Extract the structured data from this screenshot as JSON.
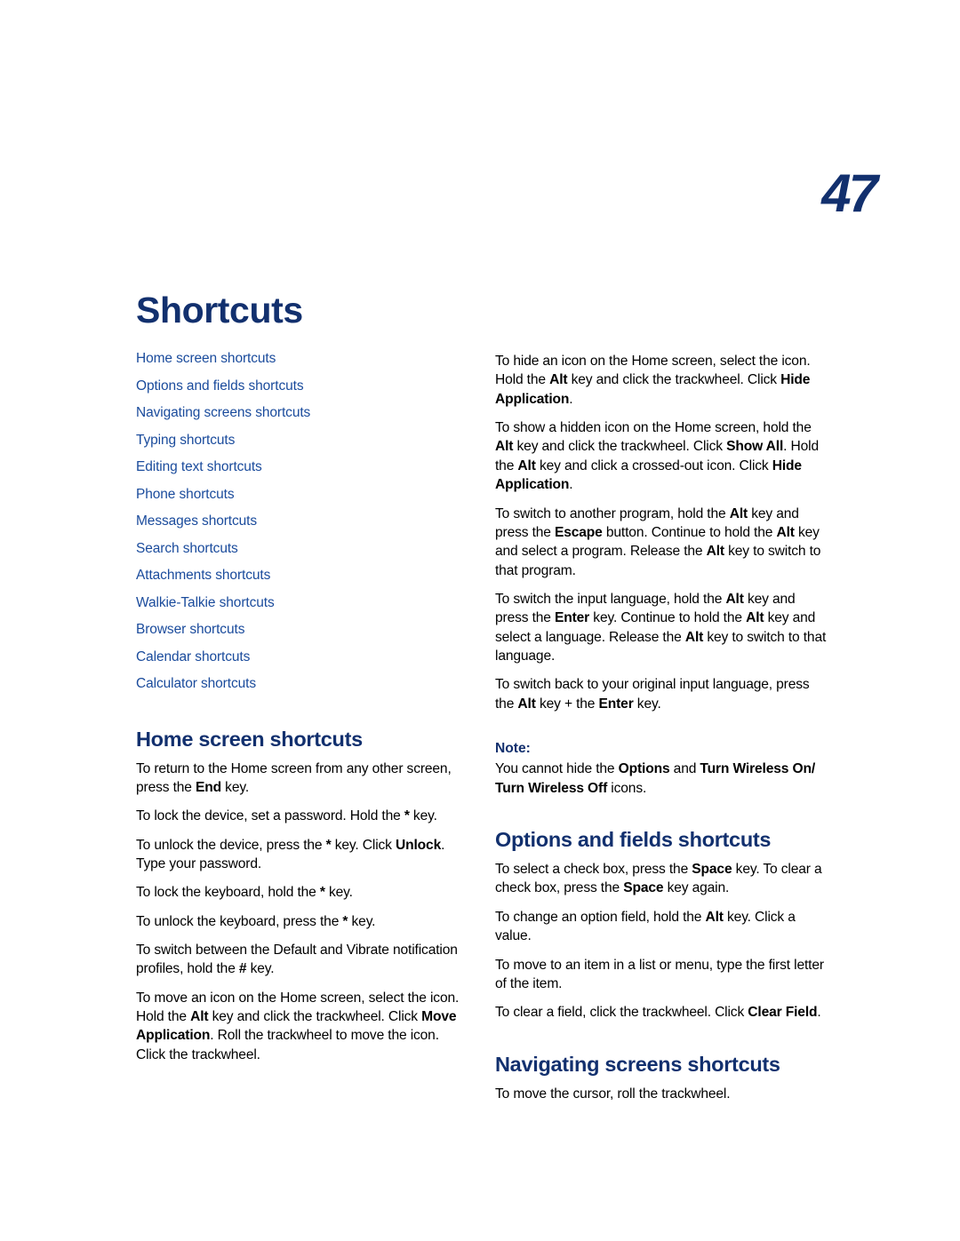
{
  "page": {
    "number": "47",
    "title": "Shortcuts"
  },
  "toc": {
    "items": [
      {
        "label": "Home screen shortcuts"
      },
      {
        "label": "Options and fields shortcuts"
      },
      {
        "label": "Navigating screens shortcuts"
      },
      {
        "label": "Typing shortcuts"
      },
      {
        "label": "Editing text shortcuts"
      },
      {
        "label": "Phone shortcuts"
      },
      {
        "label": "Messages shortcuts"
      },
      {
        "label": "Search shortcuts"
      },
      {
        "label": "Attachments shortcuts"
      },
      {
        "label": "Walkie-Talkie shortcuts"
      },
      {
        "label": "Browser shortcuts"
      },
      {
        "label": "Calendar shortcuts"
      },
      {
        "label": "Calculator shortcuts"
      }
    ]
  },
  "sections": {
    "home_screen": {
      "heading": "Home screen shortcuts",
      "paragraphs": [
        "To return to the Home screen from any other screen, press the <b>End</b> key.",
        "To lock the device, set a password. Hold the <b>*</b> key.",
        "To unlock the device, press the <b>*</b> key. Click <b>Unlock</b>. Type your password.",
        "To lock the keyboard, hold the <b>*</b> key.",
        "To unlock the keyboard, press the <b>*</b> key.",
        "To switch between the Default and Vibrate notification profiles, hold the <b>#</b> key.",
        "To move an icon on the Home screen, select the icon. Hold the <b>Alt</b> key and click the trackwheel. Click <b>Move Application</b>. Roll the trackwheel to move the icon. Click the trackwheel."
      ]
    },
    "home_screen_continued": {
      "paragraphs": [
        "To hide an icon on the Home screen, select the icon. Hold the <b>Alt</b> key and click the trackwheel. Click <b>Hide Application</b>.",
        "To show a hidden icon on the Home screen, hold the <b>Alt</b> key and click the trackwheel. Click <b>Show All</b>. Hold the <b>Alt</b> key and click a crossed-out icon. Click <b>Hide Application</b>.",
        "To switch to another program, hold the <b>Alt</b> key and press the <b>Escape</b> button. Continue to hold the <b>Alt</b> key and select a program. Release the <b>Alt</b> key to switch to that program.",
        "To switch the input language, hold the <b>Alt</b> key and press the <b>Enter</b> key. Continue to hold the <b>Alt</b> key and select a language. Release the <b>Alt</b> key to switch to that language.",
        "To switch back to your original input language, press the <b>Alt</b> key + the <b>Enter</b> key."
      ]
    },
    "note": {
      "label": "Note:",
      "text": "You cannot hide the <b>Options</b> and <b>Turn Wireless On/ Turn Wireless Off</b> icons."
    },
    "options_and_fields": {
      "heading": "Options and fields shortcuts",
      "paragraphs": [
        "To select a check box, press the <b>Space</b> key. To clear a check box, press the <b>Space</b> key again.",
        "To change an option field, hold the <b>Alt</b> key. Click a value.",
        "To move to an item in a list or menu, type the first letter of the item.",
        "To clear a field, click the trackwheel. Click <b>Clear Field</b>."
      ]
    },
    "navigating_screens": {
      "heading": "Navigating screens shortcuts",
      "paragraphs": [
        "To move the cursor, roll the trackwheel."
      ]
    }
  },
  "colors": {
    "heading_blue": "#12306e",
    "link_blue": "#1a4b9c",
    "body_black": "#000000"
  }
}
